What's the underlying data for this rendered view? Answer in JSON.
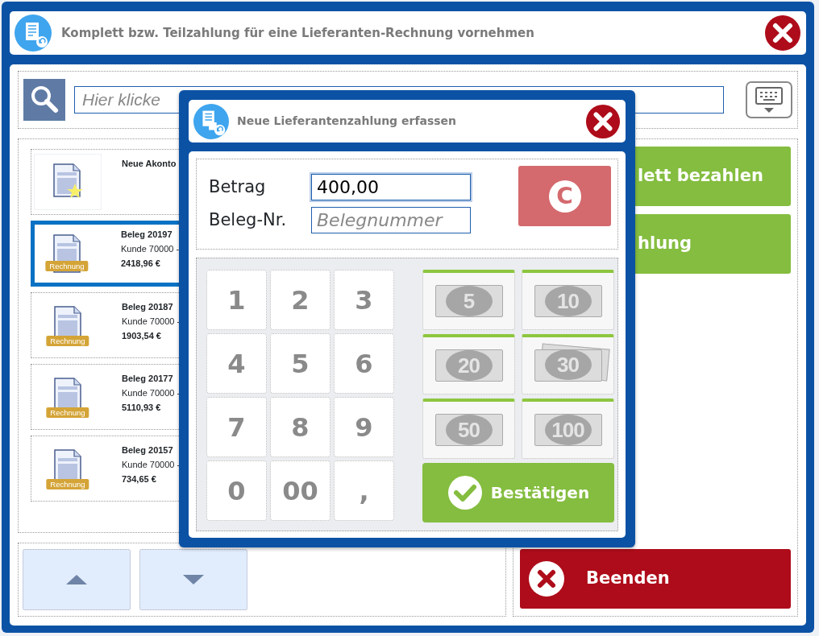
{
  "window": {
    "title": "Komplett bzw. Teilzahlung für eine Lieferanten-Rechnung vornehmen"
  },
  "search": {
    "placeholder": "Hier klicke"
  },
  "documents": [
    {
      "kind": "new",
      "title": "Neue Akonto",
      "selected": false
    },
    {
      "kind": "invoice",
      "title": "Beleg 20197",
      "customer": "Kunde 70000 -",
      "amount": "2418,96 €",
      "badge": "Rechnung",
      "selected": true
    },
    {
      "kind": "invoice",
      "title": "Beleg 20187",
      "customer": "Kunde 70000 -",
      "amount": "1903,54 €",
      "badge": "Rechnung",
      "selected": false
    },
    {
      "kind": "invoice",
      "title": "Beleg 20177",
      "customer": "Kunde 70000 -",
      "amount": "5110,93 €",
      "badge": "Rechnung",
      "selected": false
    },
    {
      "kind": "invoice",
      "title": "Beleg 20157",
      "customer": "Kunde 70000 -",
      "amount": "734,65 €",
      "badge": "Rechnung",
      "selected": false
    }
  ],
  "actions": [
    {
      "label": "lett bezahlen"
    },
    {
      "label": "hlung"
    }
  ],
  "exit_button": {
    "label": "Beenden"
  },
  "dialog": {
    "title": "Neue Lieferantenzahlung erfassen",
    "fields": [
      {
        "label": "Betrag",
        "value": "400,00"
      },
      {
        "label": "Beleg-Nr.",
        "placeholder": "Belegnummer"
      }
    ],
    "clear_key": "C",
    "keys": [
      "1",
      "2",
      "3",
      "4",
      "5",
      "6",
      "7",
      "8",
      "9",
      "0",
      "00",
      ","
    ],
    "notes": [
      {
        "label": "5",
        "kind": "single"
      },
      {
        "label": "10",
        "kind": "single"
      },
      {
        "label": "20",
        "kind": "single"
      },
      {
        "label": "30",
        "kind": "stack"
      },
      {
        "label": "50",
        "kind": "single"
      },
      {
        "label": "100",
        "kind": "single"
      }
    ],
    "confirm": "Bestätigen"
  }
}
